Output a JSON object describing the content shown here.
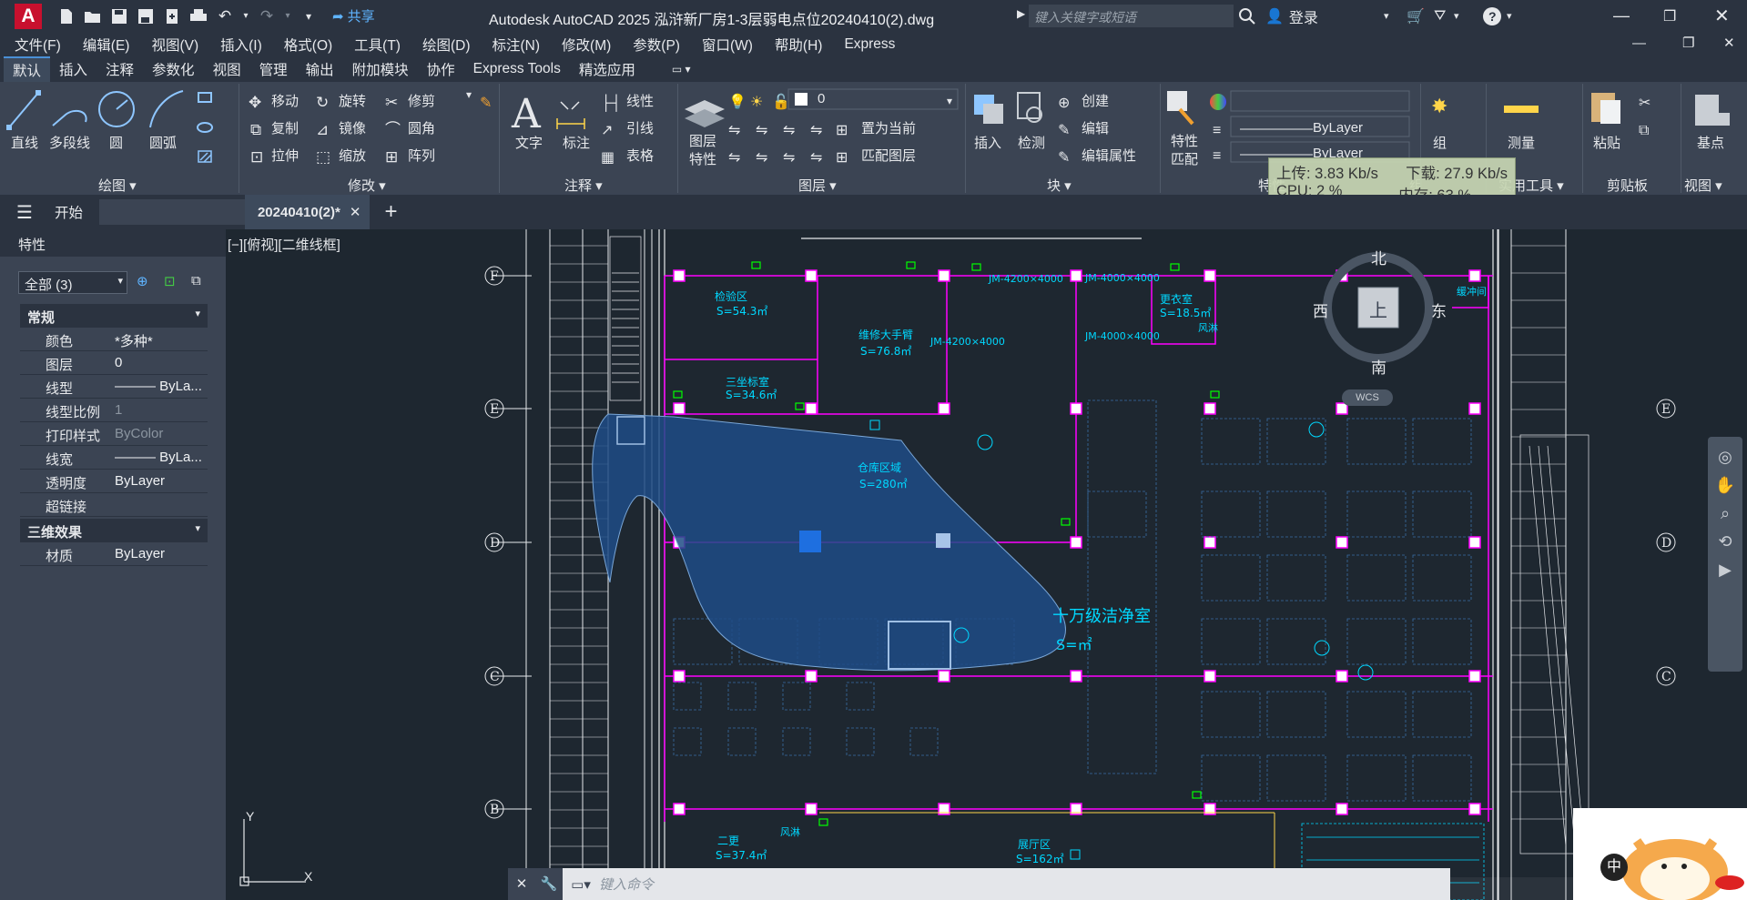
{
  "title": "Autodesk AutoCAD 2025   泓浒新厂房1-3层弱电点位20240410(2).dwg",
  "logo": "A",
  "share_label": "共享",
  "search_placeholder": "键入关键字或短语",
  "login_label": "登录",
  "menu": [
    "文件(F)",
    "编辑(E)",
    "视图(V)",
    "插入(I)",
    "格式(O)",
    "工具(T)",
    "绘图(D)",
    "标注(N)",
    "修改(M)",
    "参数(P)",
    "窗口(W)",
    "帮助(H)",
    "Express"
  ],
  "ribbon_tabs": [
    "默认",
    "插入",
    "注释",
    "参数化",
    "视图",
    "管理",
    "输出",
    "附加模块",
    "协作",
    "Express Tools",
    "精选应用"
  ],
  "ribbon": {
    "draw": {
      "line": "直线",
      "polyline": "多段线",
      "circle": "圆",
      "arc": "圆弧",
      "panel": "绘图 ▾"
    },
    "modify": {
      "move": "移动",
      "rotate": "旋转",
      "trim": "修剪",
      "copy": "复制",
      "mirror": "镜像",
      "fillet": "圆角",
      "stretch": "拉伸",
      "scale": "缩放",
      "array": "阵列",
      "panel": "修改 ▾"
    },
    "annotation": {
      "text": "文字",
      "dim": "标注",
      "linear": "线性",
      "leader": "引线",
      "table": "表格",
      "panel": "注释 ▾"
    },
    "layers": {
      "props": "图层\n特性",
      "current_layer": "0",
      "make_current": "置为当前",
      "match": "匹配图层",
      "panel": "图层 ▾"
    },
    "block": {
      "insert": "插入",
      "inspect": "检测",
      "create": "创建",
      "edit": "编辑",
      "edit_attr": "编辑属性",
      "panel": "块 ▾"
    },
    "properties": {
      "match": "特性\n匹配",
      "bylayer1": "ByLayer",
      "bylayer2": "ByLayer",
      "panel": "特性"
    },
    "groups": {
      "group": "组",
      "panel": "组"
    },
    "utilities": {
      "measure": "测量",
      "panel": "实用工具 ▾"
    },
    "clipboard": {
      "paste": "粘贴",
      "panel": "剪贴板"
    },
    "view": {
      "base": "基点",
      "panel": "视图 ▾"
    }
  },
  "netmon": {
    "upload": "上传: 3.83 Kb/s",
    "download": "下载: 27.9 Kb/s",
    "cpu": "CPU: 2 %",
    "mem": "内存: 63 %"
  },
  "file_tabs": {
    "start": "开始",
    "current": "20240410(2)*"
  },
  "properties_panel": {
    "title": "特性",
    "selection": "全部 (3)",
    "section_general": "常规",
    "rows": [
      {
        "k": "颜色",
        "v": "*多种*"
      },
      {
        "k": "图层",
        "v": "0"
      },
      {
        "k": "线型",
        "v": "——— ByLa..."
      },
      {
        "k": "线型比例",
        "v": "1"
      },
      {
        "k": "打印样式",
        "v": "ByColor"
      },
      {
        "k": "线宽",
        "v": "——— ByLa..."
      },
      {
        "k": "透明度",
        "v": "ByLayer"
      },
      {
        "k": "超链接",
        "v": ""
      }
    ],
    "section_3d": "三维效果",
    "material": {
      "k": "材质",
      "v": "ByLayer"
    }
  },
  "viewport": {
    "label": "[−][俯视][二维线框]",
    "compass": {
      "n": "北",
      "s": "南",
      "e": "东",
      "w": "西",
      "top": "上",
      "wcs": "WCS"
    },
    "grid_rows": [
      "F",
      "E",
      "D",
      "C",
      "B"
    ],
    "ucs": {
      "x": "X",
      "y": "Y"
    },
    "rooms": [
      {
        "name": "检验区",
        "area": "S=54.3㎡"
      },
      {
        "name": "维修大手臂",
        "area": "S=76.8㎡"
      },
      {
        "name": "三坐标室",
        "area": "S=34.6㎡"
      },
      {
        "name": "仓库区域",
        "area": "S=280㎡"
      },
      {
        "name": "十万级洁净室",
        "area": "S=㎡"
      },
      {
        "name": "更衣室",
        "area": "S=18.5㎡"
      },
      {
        "name": "二更",
        "area": "S=37.4㎡"
      },
      {
        "name": "展厅区",
        "area": "S=162㎡"
      }
    ],
    "doors": [
      "JM-4200×4000",
      "JM-4200×4000",
      "JM-4000×4000",
      "JM-4000×4000"
    ],
    "labels": {
      "air_shower": "风淋",
      "buffer": "缓冲间"
    }
  },
  "command_placeholder": "键入命令",
  "ime_label": "中",
  "colors": {
    "magenta": "#ff00ff",
    "cyan": "#00d8ff",
    "green": "#00ff00",
    "selection": "#1f4c86"
  }
}
